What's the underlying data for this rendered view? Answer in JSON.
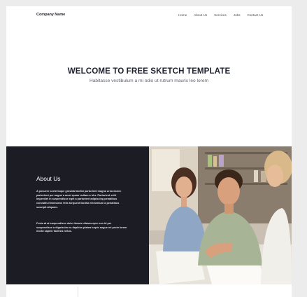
{
  "nav": {
    "brand": "Company Name",
    "links": [
      "Home",
      "About Us",
      "Services",
      "Jobs",
      "Contact Us"
    ]
  },
  "hero": {
    "title": "WELCOME TO FREE SKETCH TEMPLATE",
    "subtitle": "Habitasse vestibulum a mi odio ut rutrum mauris leo lorem"
  },
  "about": {
    "title": "About Us",
    "paragraph1": "A posuere scelerisque gravida facilisi parturient magna urna donec parturient per augue a amet quam nullam a id a. Parturient velit imperdiet in suspendisse eget a parturient adipiscing penatibus convallis himenaeos felis torquent facilisi elementum a penatibus suscipit aliquam.",
    "paragraph2": "Porta at at suspendisse dolor fames ullamcorper non id per suspendisse a dignissim eu dapibus platea turpis augue mi proin lorem morbi sapien facilisis netus."
  },
  "colors": {
    "page_bg": "#ececec",
    "dark_panel": "#1b1c24",
    "heading": "#1d2030"
  }
}
